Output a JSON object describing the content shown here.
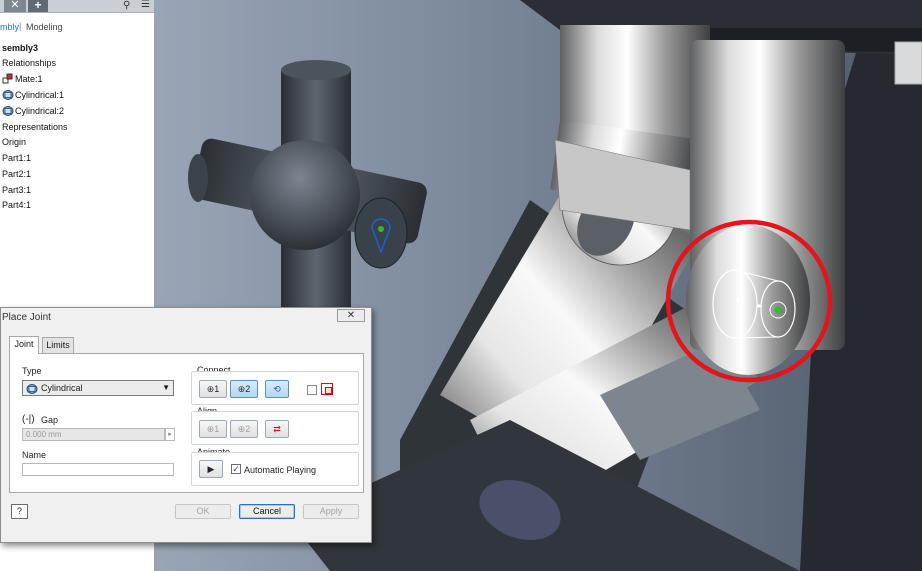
{
  "browser": {
    "tabs": {
      "active": "mbly",
      "separator": "|",
      "other": "Modeling"
    },
    "tree": [
      {
        "label": "sembly3",
        "icon": "assembly-icon",
        "root": true
      },
      {
        "label": "Relationships",
        "icon": ""
      },
      {
        "label": "Mate:1",
        "icon": "mate-constraint-icon"
      },
      {
        "label": "Cylindrical:1",
        "icon": "cylindrical-joint-icon"
      },
      {
        "label": "Cylindrical:2",
        "icon": "cylindrical-joint-icon"
      },
      {
        "label": "Representations",
        "icon": ""
      },
      {
        "label": "Origin",
        "icon": ""
      },
      {
        "label": "Part1:1",
        "icon": ""
      },
      {
        "label": "Part2:1",
        "icon": ""
      },
      {
        "label": "Part3:1",
        "icon": ""
      },
      {
        "label": "Part4:1",
        "icon": ""
      }
    ]
  },
  "dialog": {
    "title": "Place Joint",
    "close_glyph": "✕",
    "tabs": {
      "joint": "Joint",
      "limits": "Limits"
    },
    "type": {
      "label": "Type",
      "value": "Cylindrical"
    },
    "gap": {
      "label": "Gap",
      "value": "0.000 mm"
    },
    "name": {
      "label": "Name",
      "value": ""
    },
    "connect": {
      "label": "Connect",
      "btn1": "1",
      "btn2": "2"
    },
    "align": {
      "label": "Align",
      "btn1": "1",
      "btn2": "2"
    },
    "animate": {
      "label": "Animate",
      "auto_play": "Automatic Playing",
      "auto_play_checked": true
    },
    "buttons": {
      "ok": "OK",
      "cancel": "Cancel",
      "apply": "Apply"
    },
    "help_glyph": "?"
  },
  "colors": {
    "annotation_circle": "#e3141b",
    "joint_origin": "#27c22a",
    "selection_blue": "#1f5fd8",
    "dialog_bg": "#f0f0f0"
  }
}
